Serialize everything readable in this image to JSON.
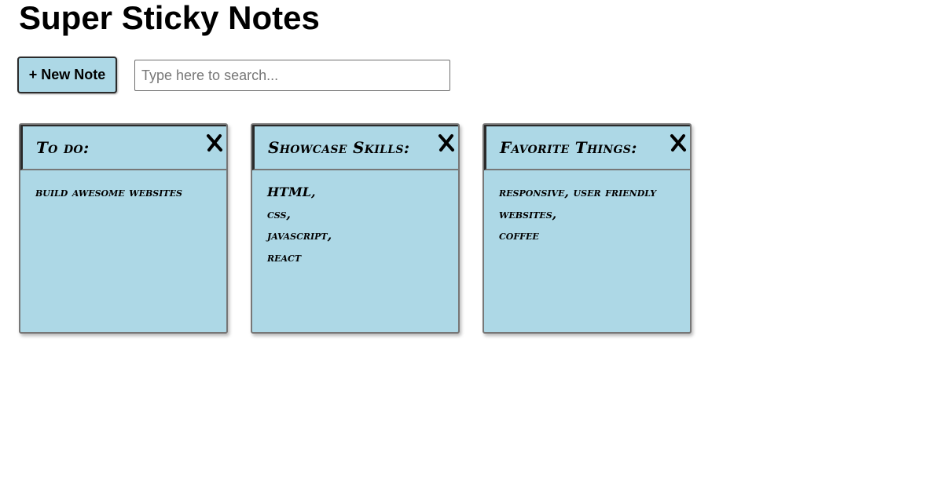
{
  "header": {
    "title": "Super Sticky Notes"
  },
  "toolbar": {
    "new_note_label": "+ New Note",
    "search_placeholder": "Type here to search...",
    "search_value": ""
  },
  "colors": {
    "note_background": "#add8e6",
    "note_border": "#777777"
  },
  "notes": [
    {
      "title": "To do:",
      "close_icon": "close-icon",
      "lines": [
        "build awesome websites"
      ]
    },
    {
      "title": "Showcase Skills:",
      "close_icon": "close-icon",
      "lines": [
        "HTML,",
        "css,",
        "javascript,",
        "react"
      ]
    },
    {
      "title": "Favorite Things:",
      "close_icon": "close-icon",
      "lines": [
        "responsive, user friendly",
        "websites,",
        "coffee"
      ]
    }
  ]
}
